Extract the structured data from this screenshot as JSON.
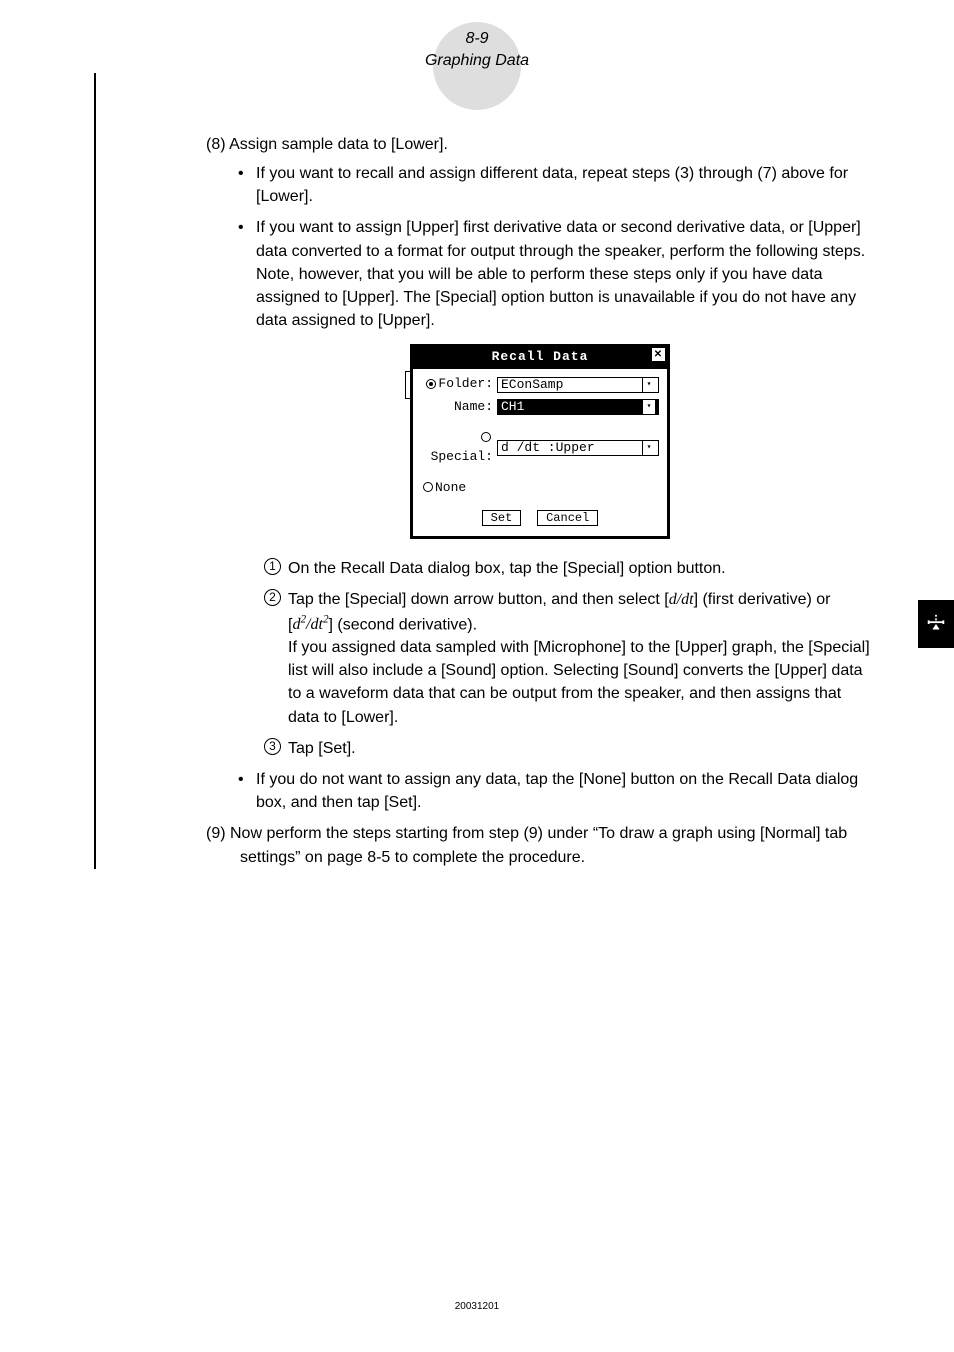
{
  "header": {
    "page_num": "8-9",
    "section": "Graphing Data"
  },
  "steps": {
    "s8": {
      "label": "(8) Assign sample data to [Lower].",
      "bullets": [
        "If you want to recall and assign different data, repeat steps (3) through (7) above for [Lower].",
        "If you want to assign [Upper] first derivative data or second derivative data, or [Upper] data converted to a format for output through the speaker, perform the following steps. Note, however, that you will be able to perform these steps only if you have data assigned to [Upper]. The [Special] option button is unavailable if you do not have any data assigned to [Upper]."
      ],
      "substeps": {
        "s1": "On the Recall Data dialog box, tap the [Special] option button.",
        "s2_a": "Tap the [Special] down arrow button, and then select [",
        "s2_b": "] (first derivative) or [",
        "s2_c": "] (second derivative).",
        "s2_note": "If you assigned data sampled with [Microphone] to the [Upper] graph, the [Special] list will also include a [Sound] option. Selecting [Sound] converts the [Upper] data to a waveform data that can be output from the speaker, and then assigns that data to [Lower].",
        "s3": "Tap [Set]."
      },
      "bullet_after": "If you do not want to assign any data, tap the [None] button on the Recall Data dialog box, and then tap [Set]."
    },
    "s9": "(9) Now perform the steps starting from step (9) under “To draw a graph using [Normal] tab settings” on page 8-5 to complete the procedure."
  },
  "dialog": {
    "title": "Recall Data",
    "folder_label": "Folder:",
    "folder_value": "EConSamp",
    "name_label": "Name:",
    "name_value": "CH1",
    "special_label": "Special:",
    "special_value": "d /dt :Upper",
    "none_label": "None",
    "set_btn": "Set",
    "cancel_btn": "Cancel"
  },
  "math": {
    "d_dt": "d/dt",
    "d2_dt2_a": "d",
    "d2_dt2_b": "/dt"
  },
  "footer": {
    "id": "20031201"
  }
}
